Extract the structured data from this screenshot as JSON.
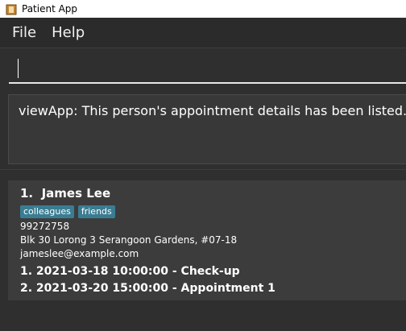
{
  "window": {
    "title": "Patient App"
  },
  "menu": {
    "file_label": "File",
    "help_label": "Help"
  },
  "command": {
    "value": ""
  },
  "result": {
    "text": "viewApp: This person's appointment details has been listed."
  },
  "person": {
    "index": "1.",
    "name": "James Lee",
    "tags": [
      "colleagues",
      "friends"
    ],
    "phone": "99272758",
    "address": "Blk 30 Lorong 3 Serangoon Gardens, #07-18",
    "email": "jameslee@example.com",
    "appointments": [
      "1. 2021-03-18 10:00:00 - Check-up",
      "2. 2021-03-20 15:00:00 - Appointment 1"
    ]
  },
  "colors": {
    "tag": "#3a7d92",
    "background": "#2f2f2f",
    "card": "#3c3c3c"
  }
}
